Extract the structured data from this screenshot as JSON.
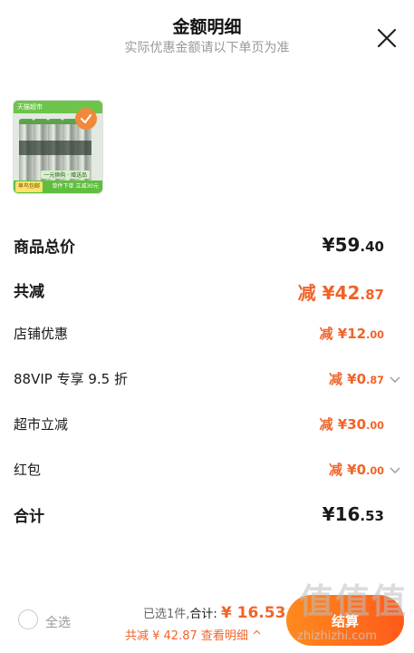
{
  "header": {
    "title": "金额明细",
    "subtitle": "实际优惠金额请以下单页为准"
  },
  "product": {
    "top_banner": "天猫超市",
    "badge_left": "早鸟包邮",
    "mid_tag": "一元换购 · 赠送品",
    "promo": "单件下单 立减30元"
  },
  "rows": {
    "goods_total": {
      "label": "商品总价",
      "prefix": "¥",
      "int": "59",
      "dec": ".40"
    },
    "total_reduce": {
      "label": "共减",
      "prefix": "减 ¥",
      "int": "42",
      "dec": ".87"
    },
    "store_discount": {
      "label": "店铺优惠",
      "prefix": "减 ¥",
      "int": "12",
      "dec": ".00"
    },
    "vip": {
      "label": "88VIP 专享 9.5 折",
      "prefix": "减 ¥",
      "int": "0",
      "dec": ".87"
    },
    "market_reduce": {
      "label": "超市立减",
      "prefix": "减 ¥",
      "int": "30",
      "dec": ".00"
    },
    "red_packet": {
      "label": "红包",
      "prefix": "减 ¥",
      "int": "0",
      "dec": ".00"
    },
    "sum": {
      "label": "合计",
      "prefix": "¥",
      "int": "16",
      "dec": ".53"
    }
  },
  "bottom": {
    "select_all": "全选",
    "selected_count": "已选1件,",
    "total_label": "合计:",
    "total_value": "¥ 16.53",
    "reduce_text": "共减 ¥ 42.87",
    "detail_link": "查看明细 ^",
    "checkout_label": "结算"
  },
  "watermark": {
    "big": "值值值",
    "small": "zhizhizhi.com"
  },
  "colors": {
    "accent": "#f0642a",
    "checkout_start": "#ff8a1e",
    "checkout_end": "#ff5a1a"
  }
}
